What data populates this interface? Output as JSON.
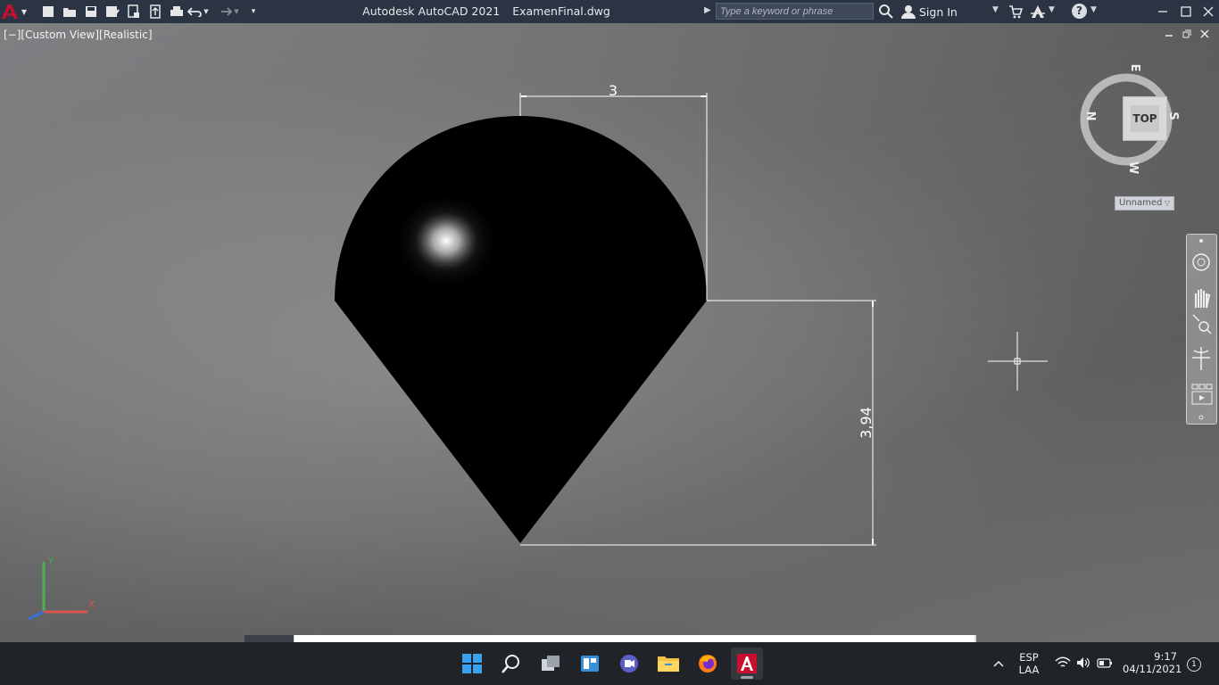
{
  "app": {
    "title": "Autodesk AutoCAD 2021",
    "filename": "ExamenFinal.dwg"
  },
  "titlebar": {
    "search_placeholder": "Type a keyword or phrase",
    "sign_in": "Sign In",
    "help_label": "?"
  },
  "viewport": {
    "label": "[−][Custom View][Realistic]"
  },
  "drawing": {
    "dimension_width": "3",
    "dimension_height": "3,94"
  },
  "viewcube": {
    "face": "TOP",
    "north": "N",
    "south": "S",
    "east": "E",
    "west": "W",
    "wcs": "Unnamed"
  },
  "ucs": {
    "x": "X",
    "y": "Y"
  },
  "taskbar": {
    "lang": "ESP",
    "layout": "LAA",
    "time": "9:17",
    "date": "04/11/2021",
    "notifications": "1"
  },
  "colors": {
    "titlebar": "#2b3443",
    "taskbar": "#202428",
    "autocad_red": "#c8102e",
    "ucs_x": "#d9534f",
    "ucs_y": "#4caf50",
    "ucs_z": "#3b6fd6"
  }
}
